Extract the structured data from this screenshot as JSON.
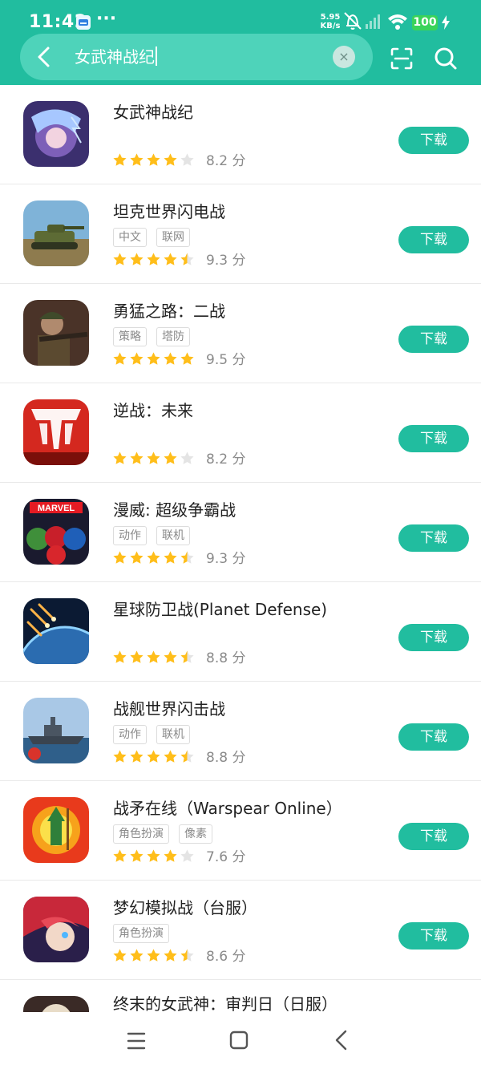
{
  "status": {
    "time": "11:42",
    "dots": "···",
    "net_speed_value": "5.95",
    "net_speed_unit": "KB/s",
    "battery": "100",
    "icons": [
      "calendar-icon",
      "mute-icon",
      "signal-icon",
      "wifi-icon",
      "charging-icon"
    ]
  },
  "search": {
    "query": "女武神战纪",
    "clear_glyph": "×"
  },
  "colors": {
    "accent": "#21bd9f",
    "search_bg": "#4ed3ba",
    "star_full": "#ffbe1a",
    "star_empty": "#e4e4e4",
    "battery": "#3ad35a"
  },
  "download_label": "下载",
  "score_unit": "分",
  "apps": [
    {
      "title": "女武神战纪",
      "tags": [],
      "score": "8.2",
      "stars": 4,
      "icon": "valkyrie-game-icon"
    },
    {
      "title": "坦克世界闪电战",
      "tags": [
        "中文",
        "联网"
      ],
      "score": "9.3",
      "stars": 4.5,
      "icon": "tank-game-icon"
    },
    {
      "title": "勇猛之路：二战",
      "tags": [
        "策略",
        "塔防"
      ],
      "score": "9.5",
      "stars": 5,
      "icon": "soldier-game-icon"
    },
    {
      "title": "逆战：未来",
      "tags": [],
      "score": "8.2",
      "stars": 4,
      "icon": "nizhan-game-icon"
    },
    {
      "title": "漫威: 超级争霸战",
      "tags": [
        "动作",
        "联机"
      ],
      "score": "9.3",
      "stars": 4.5,
      "icon": "marvel-game-icon"
    },
    {
      "title": "星球防卫战(Planet Defense)",
      "tags": [],
      "score": "8.8",
      "stars": 4.5,
      "icon": "planet-game-icon"
    },
    {
      "title": "战舰世界闪击战",
      "tags": [
        "动作",
        "联机"
      ],
      "score": "8.8",
      "stars": 4.5,
      "icon": "warship-game-icon"
    },
    {
      "title": "战矛在线（Warspear Online）",
      "tags": [
        "角色扮演",
        "像素"
      ],
      "score": "7.6",
      "stars": 4,
      "icon": "warspear-game-icon"
    },
    {
      "title": "梦幻模拟战（台服）",
      "tags": [
        "角色扮演"
      ],
      "score": "8.6",
      "stars": 4.5,
      "icon": "langrisser-game-icon"
    }
  ],
  "partial_app": {
    "title": "终末的女武神：审判日（日服）",
    "icon": "record-of-ragnarok-game-icon"
  }
}
